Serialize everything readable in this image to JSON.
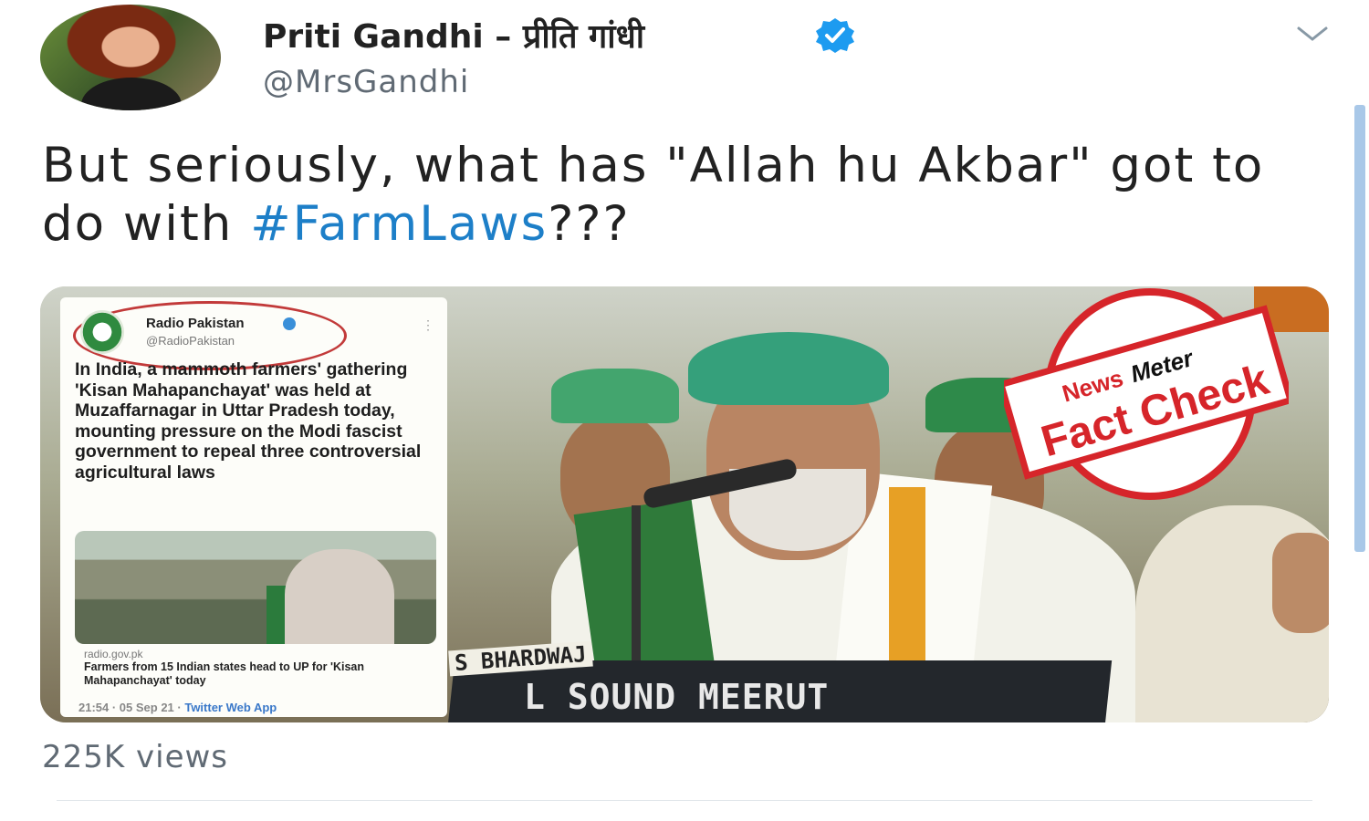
{
  "author": {
    "display_name": "Priti Gandhi – प्रीति गांधी",
    "handle": "@MrsGandhi",
    "verified": true
  },
  "tweet": {
    "text_before": "But seriously, what has \"Allah hu Akbar\" got to do with ",
    "hashtag": "#FarmLaws",
    "text_after": "???",
    "hashtag_color": "#1d7fc8"
  },
  "embedded_screenshot": {
    "name": "Radio Pakistan",
    "handle": "@RadioPakistan",
    "body": "In India, a mammoth farmers' gathering 'Kisan Mahapanchayat' was held at Muzaffarnagar in Uttar Pradesh today, mounting pressure on the Modi fascist government to repeal three controversial agricultural laws",
    "link_domain": "radio.gov.pk",
    "link_title": "Farmers from 15 Indian states head to UP for 'Kisan Mahapanchayat' today",
    "timestamp": "21:54 · 05 Sep 21 · ",
    "app": "Twitter Web App"
  },
  "video_scene": {
    "banner_text": "S BHARDWAJ",
    "podium_text": "L SOUND MEERUT"
  },
  "stamp": {
    "brand_left": "News",
    "brand_right": "Meter",
    "label": "Fact Check",
    "color": "#d6252a"
  },
  "views": "225K views",
  "icons": [
    "verified-badge-icon",
    "chevron-down-icon"
  ]
}
